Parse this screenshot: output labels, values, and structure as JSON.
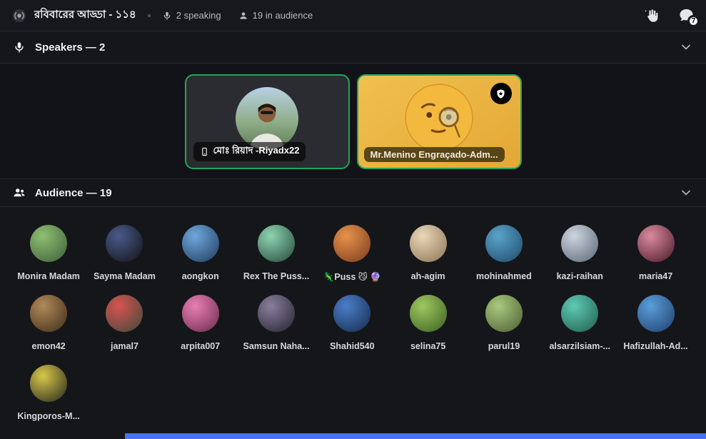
{
  "topbar": {
    "title": "রবিবারের আড্ডা - ১১৪",
    "speaking": "2 speaking",
    "in_audience": "19 in audience",
    "chat_badge": "7"
  },
  "speakers": {
    "header": "Speakers — 2",
    "cards": [
      {
        "name": "মোঃ রিয়াদ -Riyadx22",
        "speaking": true,
        "style": "dark"
      },
      {
        "name": "Mr.Menino Engraçado-Adm...",
        "speaking": true,
        "style": "gold",
        "badge": "moderator-shield-star"
      }
    ]
  },
  "audience": {
    "header": "Audience — 19",
    "members": [
      {
        "name": "Monira Madam",
        "c1": "#8fbf72",
        "c2": "#3c5e3a"
      },
      {
        "name": "Sayma Madam",
        "c1": "#4a5a8a",
        "c2": "#121318"
      },
      {
        "name": "aongkon",
        "c1": "#6fa8dc",
        "c2": "#1f3a5f"
      },
      {
        "name": "Rex The Puss...",
        "c1": "#8fd4b2",
        "c2": "#23483a"
      },
      {
        "name": "🦎Puss 😼 🔮",
        "c1": "#e8924a",
        "c2": "#7a3c1e"
      },
      {
        "name": "ah-agim",
        "c1": "#ead8b8",
        "c2": "#8a7355"
      },
      {
        "name": "mohinahmed",
        "c1": "#5ba3c9",
        "c2": "#1e4a6b"
      },
      {
        "name": "kazi-raihan",
        "c1": "#cdd5de",
        "c2": "#5a6675"
      },
      {
        "name": "maria47",
        "c1": "#d98a9e",
        "c2": "#4a1a28"
      },
      {
        "name": "emon42",
        "c1": "#b08a5a",
        "c2": "#3e2c18"
      },
      {
        "name": "jamal7",
        "c1": "#d9534f",
        "c2": "#3a4a3a"
      },
      {
        "name": "arpita007",
        "c1": "#e87fb5",
        "c2": "#6b2a4a"
      },
      {
        "name": "Samsun Naha...",
        "c1": "#8a7f9e",
        "c2": "#25212e"
      },
      {
        "name": "Shahid540",
        "c1": "#4a7ec9",
        "c2": "#152a4a"
      },
      {
        "name": "selina75",
        "c1": "#9ec961",
        "c2": "#3a5e1f"
      },
      {
        "name": "parul19",
        "c1": "#aac97e",
        "c2": "#4a5e33"
      },
      {
        "name": "alsarzilsiam-...",
        "c1": "#5ec9b5",
        "c2": "#1f5e4a"
      },
      {
        "name": "Hafizullah-Ad...",
        "c1": "#5a9ed9",
        "c2": "#1f3e6b"
      },
      {
        "name": "Kingporos-M...",
        "c1": "#d9c94a",
        "c2": "#23231c"
      }
    ]
  },
  "footer": {
    "strip_color": "#4a72f5"
  },
  "colors": {
    "speaking_ring": "#23a55a",
    "gold_card": "#e8b343"
  }
}
